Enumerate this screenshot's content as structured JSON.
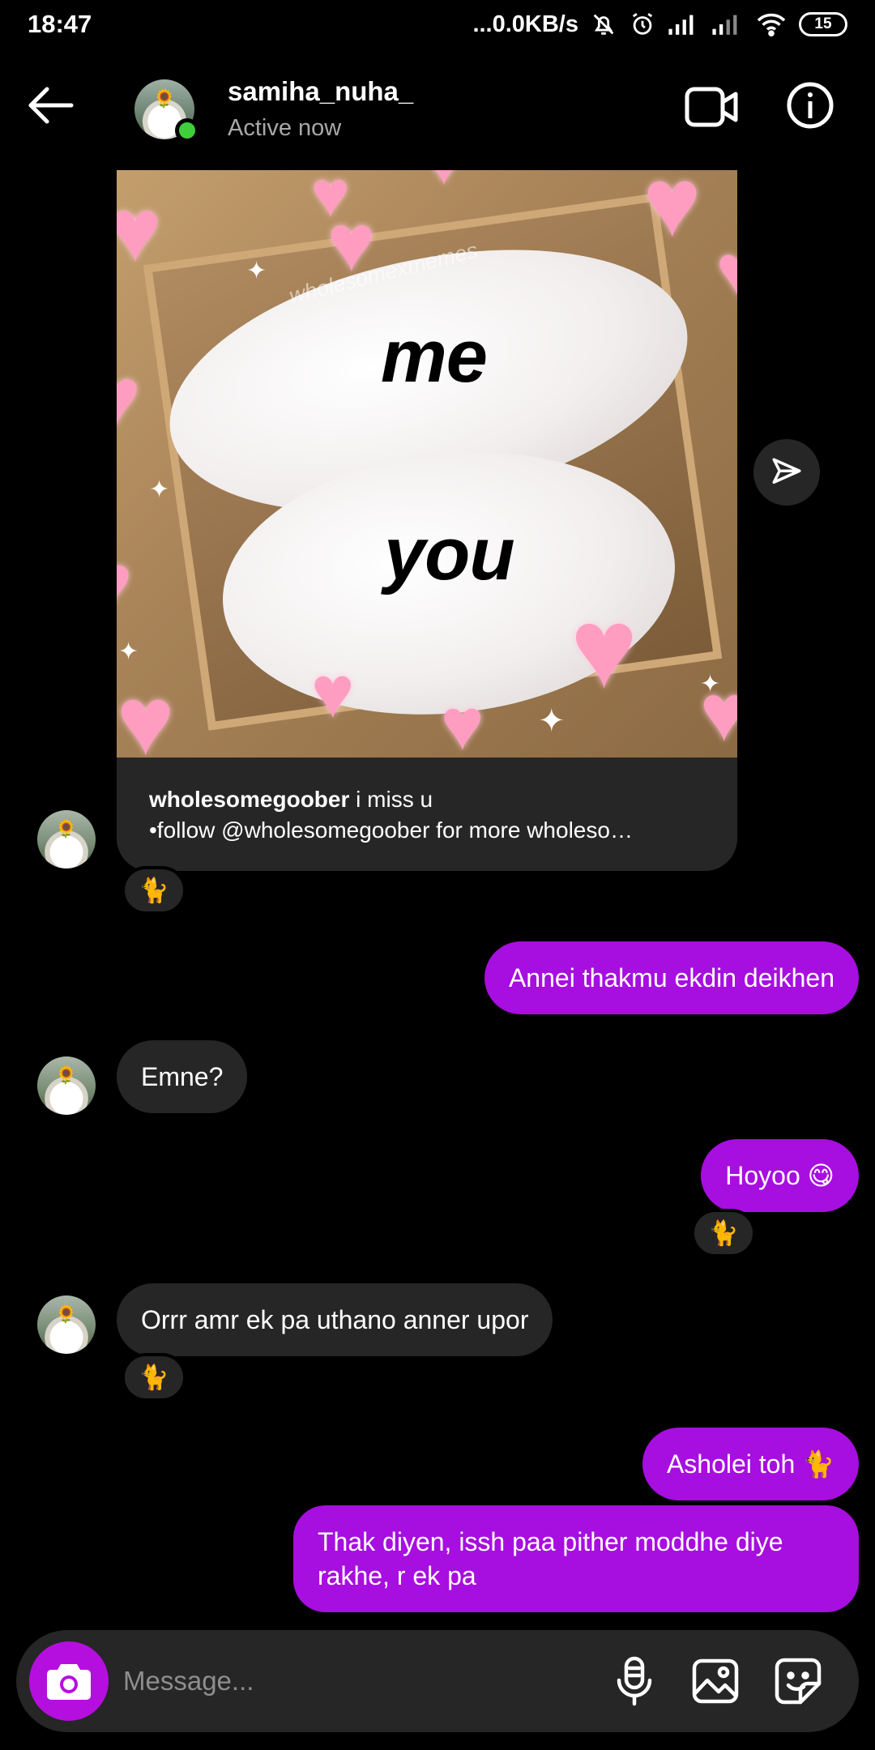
{
  "status_bar": {
    "time": "18:47",
    "network_speed": "...0.0KB/s",
    "battery": "15"
  },
  "header": {
    "username": "samiha_nuha_",
    "status": "Active now"
  },
  "post": {
    "meme_top": "me",
    "meme_bottom": "you",
    "watermark": "wholesomexmemes",
    "caption_user": "wholesomegoober",
    "caption_text": " i miss u",
    "caption_line2": "•follow @wholesomegoober for more wholeso…",
    "reaction": "🐈"
  },
  "messages": [
    {
      "direction": "out",
      "text": "Annei thakmu ekdin deikhen"
    },
    {
      "direction": "in",
      "text": "Emne?"
    },
    {
      "direction": "out",
      "text": "Hoyoo 😋",
      "reaction": "🐈"
    },
    {
      "direction": "in",
      "text": "Orrr amr ek pa uthano anner upor",
      "reaction": "🐈"
    },
    {
      "direction": "out",
      "text": "Asholei toh 🐈"
    },
    {
      "direction": "out",
      "text": "Thak diyen, issh paa pither moddhe diye rakhe, r ek pa"
    }
  ],
  "composer": {
    "placeholder": "Message..."
  },
  "colors": {
    "outgoing_bubble": "#a70ee0",
    "incoming_bubble": "#262626",
    "online_dot": "#3fcf3a",
    "camera_button": "#b50fe0"
  }
}
